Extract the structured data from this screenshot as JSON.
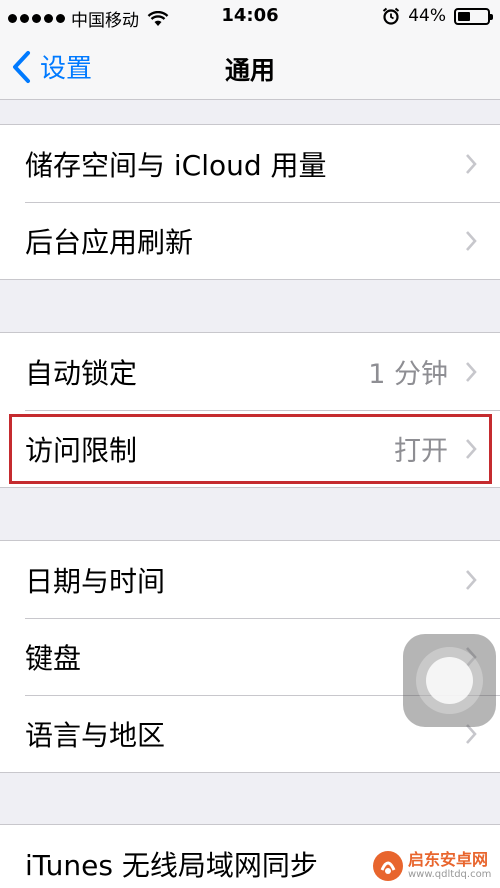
{
  "status_bar": {
    "carrier": "中国移动",
    "time": "14:06",
    "battery_percent_label": "44%",
    "battery_level": 0.44
  },
  "nav": {
    "back_label": "设置",
    "title": "通用"
  },
  "groups": [
    {
      "rows": [
        {
          "label": "储存空间与 iCloud 用量",
          "value": ""
        },
        {
          "label": "后台应用刷新",
          "value": ""
        }
      ]
    },
    {
      "rows": [
        {
          "label": "自动锁定",
          "value": "1 分钟"
        },
        {
          "label": "访问限制",
          "value": "打开"
        }
      ]
    },
    {
      "rows": [
        {
          "label": "日期与时间",
          "value": ""
        },
        {
          "label": "键盘",
          "value": ""
        },
        {
          "label": "语言与地区",
          "value": ""
        }
      ]
    },
    {
      "rows": [
        {
          "label": "iTunes 无线局域网同步",
          "value": ""
        }
      ]
    }
  ],
  "watermark": {
    "name": "启东安卓网",
    "url": "www.qdltdq.com"
  },
  "colors": {
    "accent": "#007aff",
    "highlight_border": "#c52b2f",
    "secondary_text": "#8e8e93"
  }
}
